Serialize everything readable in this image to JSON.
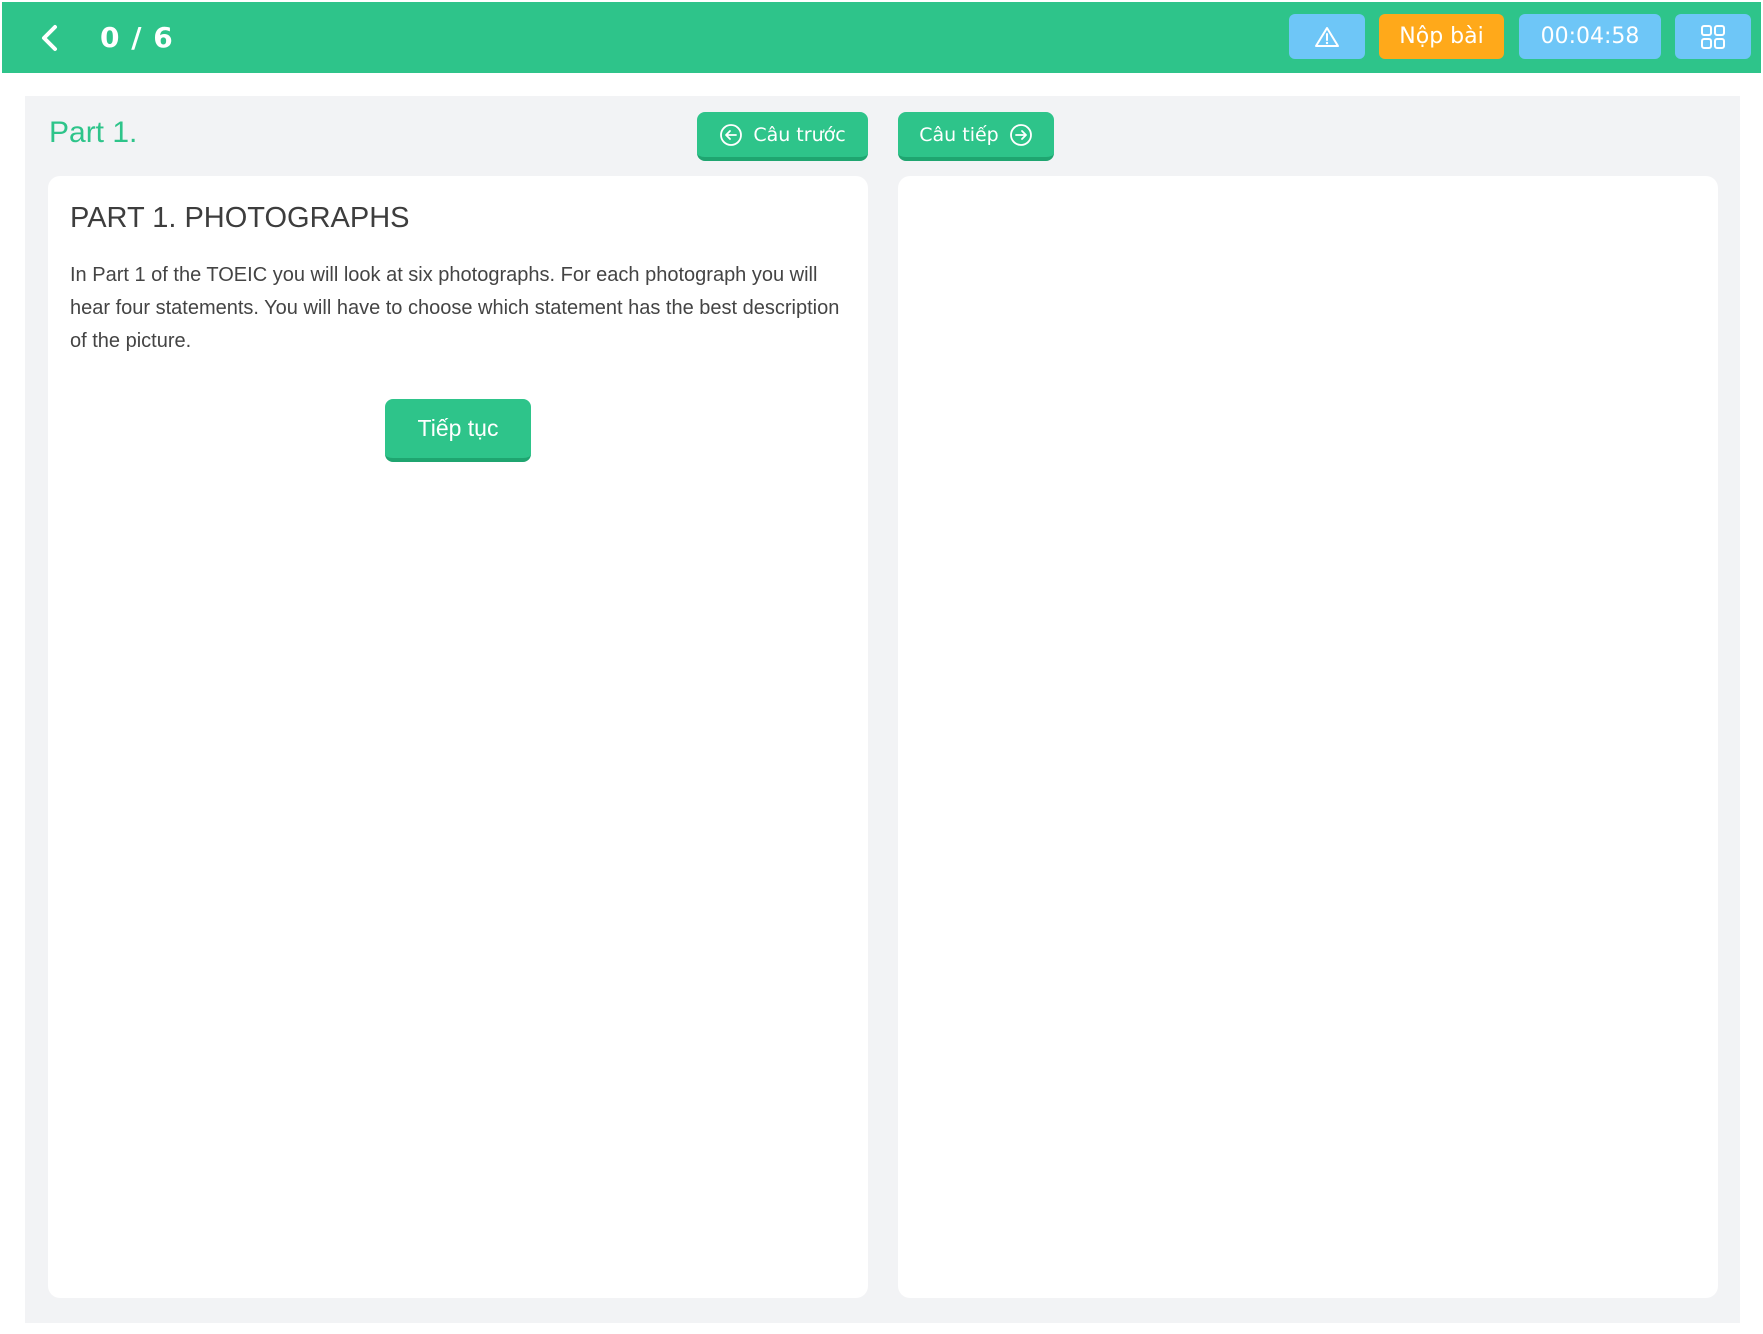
{
  "header": {
    "progress": "0 / 6",
    "submit_label": "Nộp bài",
    "timer": "00:04:58",
    "icons": {
      "back": "chevron-left-icon",
      "warn": "warning-triangle-icon",
      "grid": "grid-icon"
    }
  },
  "section": {
    "title": "Part 1.",
    "prev_label": "Câu trước",
    "next_label": "Câu tiếp"
  },
  "card": {
    "heading": "PART 1. PHOTOGRAPHS",
    "body": "In Part 1 of the TOEIC you will look at six photographs. For each photograph you will hear four statements. You will have to choose which statement has the best description of the picture.",
    "continue_label": "Tiếp tục"
  },
  "colors": {
    "accent": "#2ec48a",
    "submit": "#ffa91a",
    "info": "#6ec6f7",
    "panel": "#f2f3f5"
  }
}
